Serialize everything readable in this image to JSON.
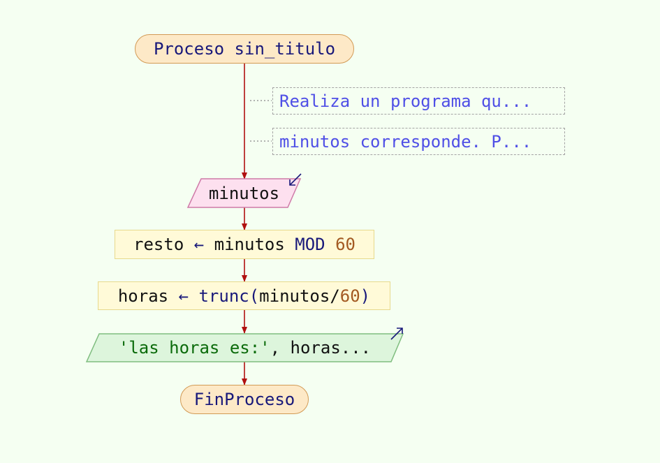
{
  "colors": {
    "background": "#f5fff2",
    "flow_line": "#b01010",
    "comment_link": "#9a9a9a",
    "terminal_fill": "#fde9c7",
    "terminal_border": "#d29a55",
    "input_fill": "#fde0ef",
    "input_border": "#cf7aa8",
    "assign_fill": "#fffad8",
    "assign_border": "#e7d98c",
    "output_fill": "#ddf5dc",
    "output_border": "#7fbd7f",
    "keyword": "#18187a",
    "number": "#a35a22",
    "string": "#0b6b0b",
    "comment_text": "#4f4fe6"
  },
  "diagram": {
    "start": {
      "label": "Proceso sin_titulo"
    },
    "comments": [
      {
        "text": "Realiza un programa qu..."
      },
      {
        "text": "minutos corresponde. P..."
      }
    ],
    "input": {
      "label": "minutos",
      "arrow_icon": "input-arrow-icon"
    },
    "assign1": {
      "var": "resto",
      "arrow": "←",
      "expr": "minutos",
      "op": "MOD",
      "num": "60"
    },
    "assign2": {
      "var": "horas",
      "arrow": "←",
      "func": "trunc",
      "open": "(",
      "arg": "minutos/",
      "num": "60",
      "close": ")"
    },
    "output": {
      "str": "'las horas es:'",
      "rest": ", horas...",
      "arrow_icon": "output-arrow-icon"
    },
    "end": {
      "label": "FinProceso"
    }
  }
}
